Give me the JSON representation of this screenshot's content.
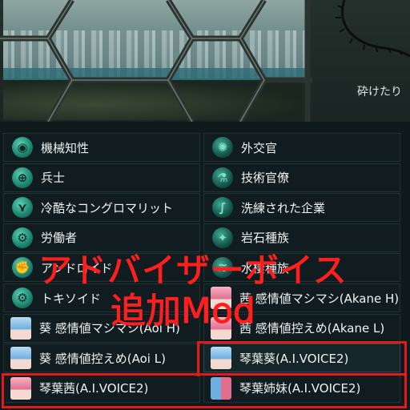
{
  "top": {
    "side_text": "砕けたり"
  },
  "overlay": {
    "line1": "アドバイザーボイス",
    "line2": "追加Mod"
  },
  "advisors": [
    {
      "label": "機械知性",
      "icon": "circuit-brain-icon"
    },
    {
      "label": "外交官",
      "icon": "spiral-swirl-icon"
    },
    {
      "label": "兵士",
      "icon": "crosshair-icon"
    },
    {
      "label": "技術官僚",
      "icon": "microscope-icon"
    },
    {
      "label": "冷酷なコングロマリット",
      "icon": "arrow-k-icon"
    },
    {
      "label": "洗練された企業",
      "icon": "s-curve-icon"
    },
    {
      "label": "労働者",
      "icon": "gear-hand-icon"
    },
    {
      "label": "岩石種族",
      "icon": "rock-cluster-icon"
    },
    {
      "label": "アンドロイド",
      "icon": "fist-icon"
    },
    {
      "label": "水棲種族",
      "icon": "wave-creature-icon"
    },
    {
      "label": "トキソイド",
      "icon": "gear-skull-icon"
    },
    {
      "label": "茜 感情値マシマシ(Akane H)",
      "icon": "akane-avatar-icon"
    },
    {
      "label": "葵 感情値マシマシ(Aoi H)",
      "icon": "aoi-avatar-icon"
    },
    {
      "label": "茜 感情値控えめ(Akane L)",
      "icon": "akane-avatar-icon"
    },
    {
      "label": "葵 感情値控えめ(Aoi L)",
      "icon": "aoi-avatar-icon"
    },
    {
      "label": "琴葉葵(A.I.VOICE2)",
      "icon": "aoi-avatar-icon"
    },
    {
      "label": "琴葉茜(A.I.VOICE2)",
      "icon": "akane-avatar-icon"
    },
    {
      "label": "琴葉姉妹(A.I.VOICE2)",
      "icon": "sisters-avatar-icon"
    }
  ],
  "colors": {
    "highlight": "#e21a1a",
    "accent": "#1e8a73"
  }
}
